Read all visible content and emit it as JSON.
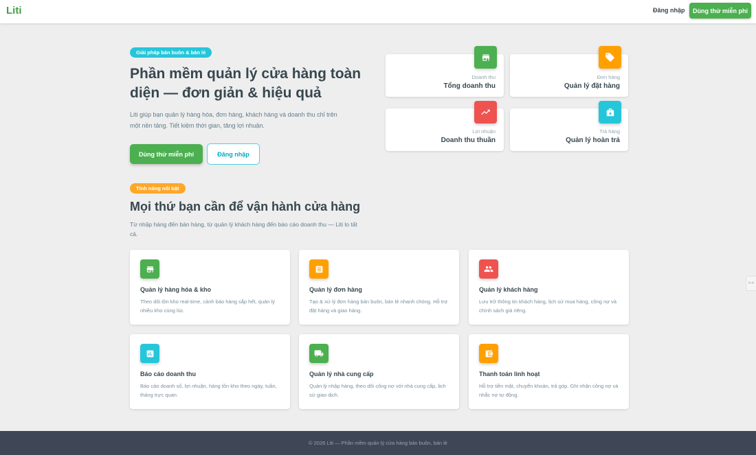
{
  "header": {
    "logo": "Liti",
    "login_label": "Đăng nhập",
    "trial_label": "Dùng thử miễn phí"
  },
  "hero": {
    "badge": "Giải pháp bán buôn & bán lẻ",
    "title": "Phần mềm quản lý cửa hàng toàn diện — đơn giản & hiệu quả",
    "description": "Liti giúp bạn quản lý hàng hóa, đơn hàng, khách hàng và doanh thu chỉ trên một nền tảng. Tiết kiệm thời gian, tăng lợi nhuận.",
    "primary_button": "Dùng thử miễn phí",
    "secondary_button": "Đăng nhập"
  },
  "stats": [
    {
      "label": "Doanh thu",
      "value": "Tổng doanh thu",
      "icon": "store-icon",
      "color": "#4caf50"
    },
    {
      "label": "Đơn hàng",
      "value": "Quản lý đặt hàng",
      "icon": "tag-icon",
      "color": "#ffa000"
    },
    {
      "label": "Lợi nhuận",
      "value": "Doanh thu thuần",
      "icon": "trending-up-icon",
      "color": "#ef5350"
    },
    {
      "label": "Trả hàng",
      "value": "Quản lý hoàn trả",
      "icon": "return-box-icon",
      "color": "#26c6da"
    }
  ],
  "features_section": {
    "badge": "Tính năng nổi bật",
    "title": "Mọi thứ bạn cần để vận hành cửa hàng",
    "description": "Từ nhập hàng đến bán hàng, từ quản lý khách hàng đến báo cáo doanh thu — Liti lo tất cả."
  },
  "features": [
    {
      "title": "Quản lý hàng hóa & kho",
      "description": "Theo dõi tồn kho real-time, cảnh báo hàng sắp hết, quản lý nhiều kho cùng lúc.",
      "icon": "warehouse-icon",
      "color": "#4caf50"
    },
    {
      "title": "Quản lý đơn hàng",
      "description": "Tạo & xử lý đơn hàng bán buôn, bán lẻ nhanh chóng. Hỗ trợ đặt hàng và giao hàng.",
      "icon": "receipt-icon",
      "color": "#ffa000"
    },
    {
      "title": "Quản lý khách hàng",
      "description": "Lưu trữ thông tin khách hàng, lịch sử mua hàng, công nợ và chính sách giá riêng.",
      "icon": "people-icon",
      "color": "#ef5350"
    },
    {
      "title": "Báo cáo doanh thu",
      "description": "Báo cáo doanh số, lợi nhuận, hàng tồn kho theo ngày, tuần, tháng trực quan.",
      "icon": "bar-chart-icon",
      "color": "#26c6da"
    },
    {
      "title": "Quản lý nhà cung cấp",
      "description": "Quản lý nhập hàng, theo dõi công nợ với nhà cung cấp, lịch sử giao dịch.",
      "icon": "truck-icon",
      "color": "#4caf50"
    },
    {
      "title": "Thanh toán linh hoạt",
      "description": "Hỗ trợ tiền mặt, chuyển khoản, trả góp. Ghi nhận công nợ và nhắc nợ tự động.",
      "icon": "wallet-icon",
      "color": "#ffa000"
    }
  ],
  "side_tab": {
    "label": ">-<"
  },
  "footer": {
    "text": "© 2026 Liti — Phần mềm quản lý cửa hàng bán buôn, bán lẻ"
  }
}
